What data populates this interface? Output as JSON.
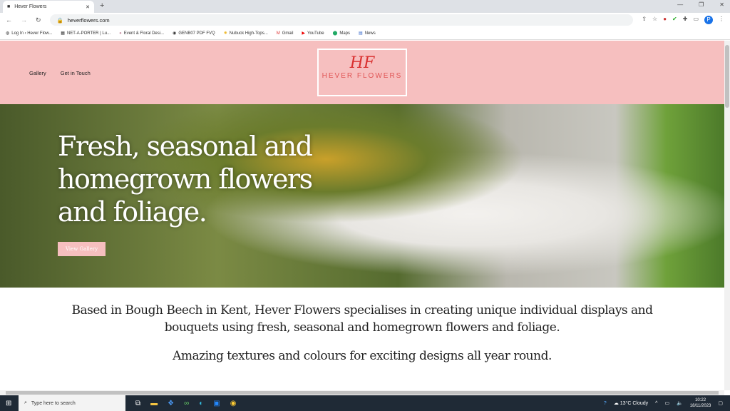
{
  "browser": {
    "tab_title": "Hever Flowers",
    "url": "heverflowers.com",
    "bookmarks": [
      "Log In ‹ Hever Flow...",
      "NET-A-PORTER | Lu...",
      "Event & Floral Desi...",
      "GENB07 PDF FVQ",
      "Nubuck High-Tops...",
      "Gmail",
      "YouTube",
      "Maps",
      "News"
    ],
    "profile_initial": "P"
  },
  "site": {
    "nav": [
      "Gallery",
      "Get in Touch"
    ],
    "logo_monogram": "HF",
    "logo_name": "HEVER FLOWERS",
    "hero_title": "Fresh, seasonal and homegrown flowers and foliage.",
    "hero_button": "View Gallery",
    "intro": "Based in Bough Beech in Kent, Hever Flowers specialises in creating unique individual displays and bouquets using fresh, seasonal and homegrown flowers and foliage.",
    "tagline": "Amazing textures and colours for exciting designs all year round."
  },
  "taskbar": {
    "search_placeholder": "Type here to search",
    "weather": "13°C  Cloudy",
    "time": "10:22",
    "date": "18/11/2023"
  }
}
